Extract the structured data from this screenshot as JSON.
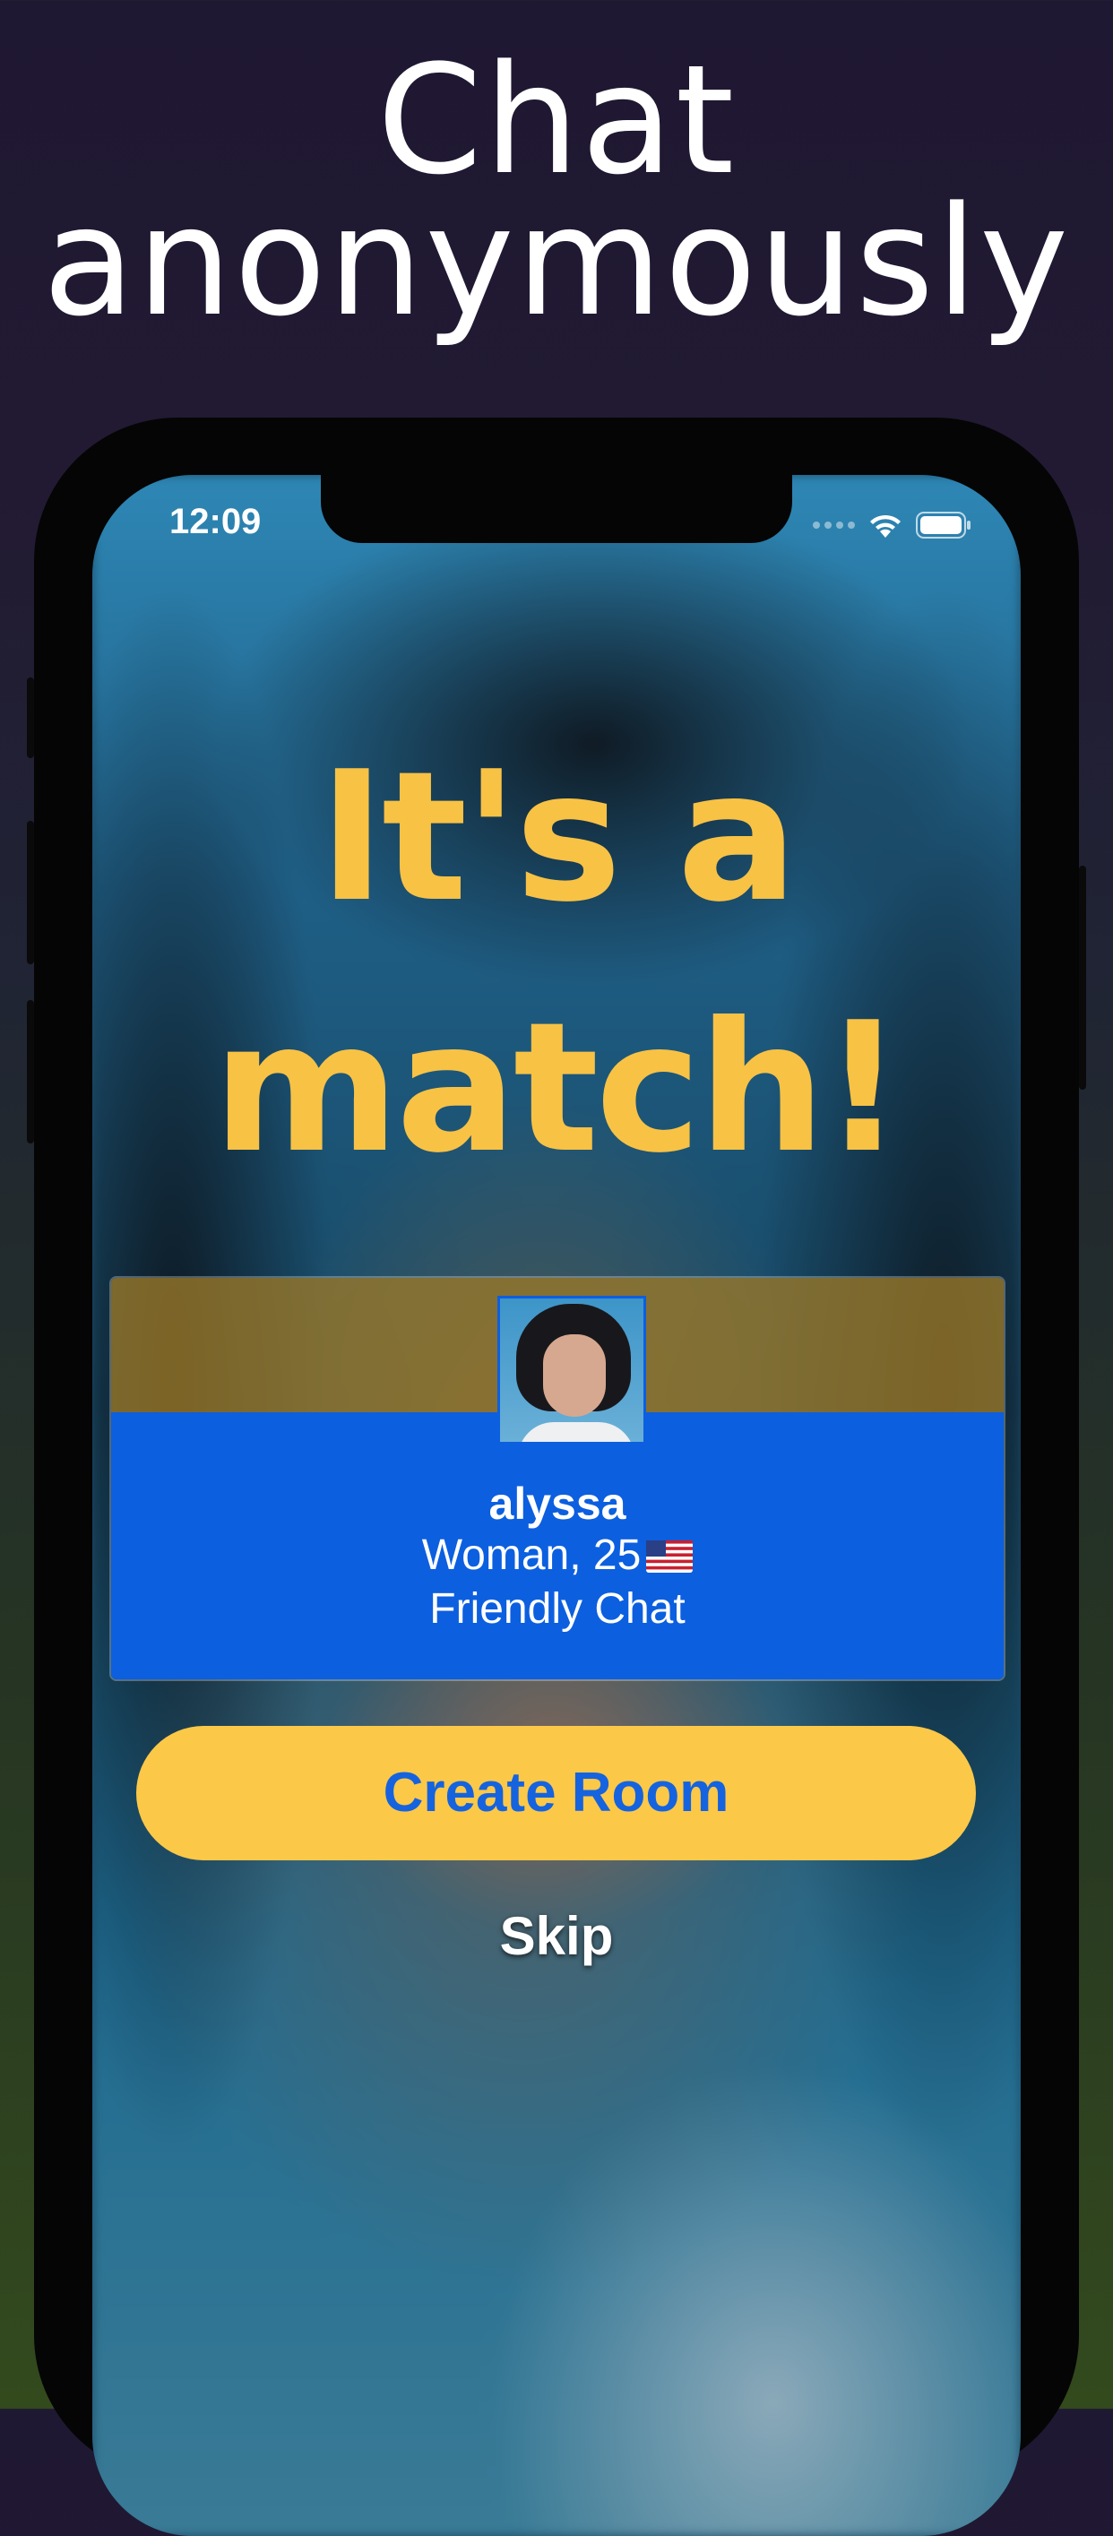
{
  "headline": {
    "line1": "Chat",
    "line2": "anonymously"
  },
  "status_bar": {
    "time": "12:09",
    "icons": [
      "signal-icon",
      "wifi-icon",
      "battery-icon"
    ]
  },
  "match": {
    "line1": "It's a",
    "line2": "match!"
  },
  "profile": {
    "name": "alyssa",
    "details": "Woman, 25",
    "flag": "us-flag-icon",
    "tagline": "Friendly Chat"
  },
  "actions": {
    "create_room": "Create Room",
    "skip": "Skip"
  },
  "colors": {
    "accent_yellow": "#f8c245",
    "accent_blue": "#0c5fdf",
    "button_text": "#1563df"
  }
}
